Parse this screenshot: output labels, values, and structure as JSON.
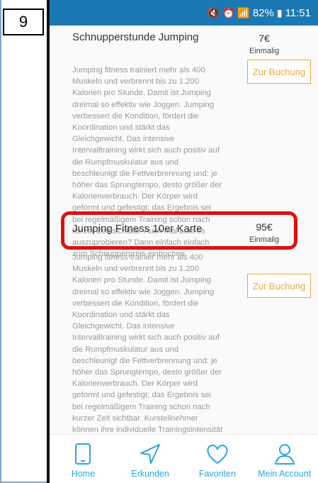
{
  "annotation": {
    "step_number": "9"
  },
  "status_bar": {
    "battery": "82%",
    "time": "11:51"
  },
  "courses": [
    {
      "title": "Schnupperstunde Jumping",
      "price": "7€",
      "frequency": "Einmalig",
      "book_label": "Zur Buchung",
      "description": "Jumping fitness trainiert mehr als 400 Muskeln und verbrennt bis zu 1.200 Kalorien pro Stunde. Damit ist Jumping dreimal so effektiv wie Joggen. Jumping verbessert die Kondition, fördert die Koordination und stärkt das Gleichgewicht. Das intensive Intervalltraining wirkt sich auch positiv auf die Rumpfmuskulatur aus und beschleunigt die Fettverbrennung und: je höher das Sprungtempo, desto größer der Kalorienverbrauch. Der Körper wird geformt und gefestigt; das Ergebnis sei bei regelmäßigem Training schon nach kurzer Zeit sichtbar. Auch mal Lust es auszuprobieren? Dann einfach einfach zum Schnupperpreis einbuchen."
    },
    {
      "title": "Jumping Fitness 10er Karte",
      "price": "95€",
      "frequency": "Einmalig",
      "book_label": "Zur Buchung",
      "description": "Jumping fitness trainier mehr als 400 Muskeln und verbrennt bis zu 1.200 Kalorien pro Stunde. Damit ist Jumping dreimal so effektiv wie Joggen. Jumping verbessert die Kondition, fördert die Koordination und stärkt das Gleichgewicht. Das intensive Intervalltraining wirkt sich auch positiv auf die Rumpfmuskulatur aus und beschleunigt die Fettverbrennung und: je höher das Sprungtempo, desto größer der Kalorienverbrauch. Der Körper wird geformt und gefestigt; das Ergebnis sei bei regelmäßigem Training schon nach kurzer Zeit sichtbar. Kursteilnehmer können ihre individuelle Trainingsintensität auf dem Trampolin jederzeit"
    }
  ],
  "bottom_nav": [
    {
      "label": "Home",
      "icon": "tablet-icon"
    },
    {
      "label": "Erkunden",
      "icon": "navigation-arrow-icon"
    },
    {
      "label": "Favoriten",
      "icon": "heart-icon"
    },
    {
      "label": "Mein Account",
      "icon": "user-icon"
    }
  ],
  "colors": {
    "status_bar": "#1b78b3",
    "accent_orange": "#f2a53a",
    "nav_blue": "#29a6e0",
    "highlight_red": "#e01010"
  }
}
